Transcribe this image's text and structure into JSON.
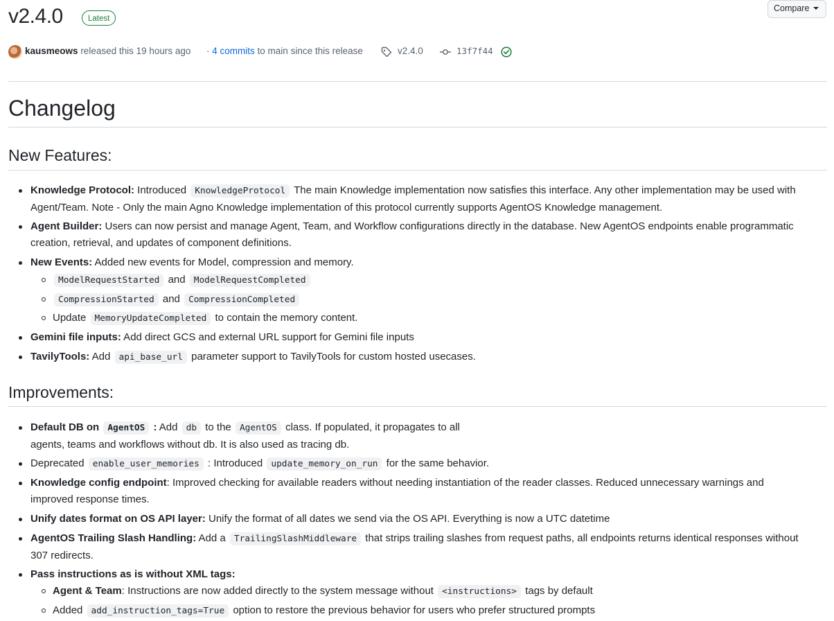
{
  "release": {
    "version": "v2.4.0",
    "badge": "Latest",
    "compare_label": "Compare",
    "author": "kausmeows",
    "released_text": "released this 19 hours ago",
    "commits_link": "4 commits",
    "commits_suffix": "to main since this release",
    "tag": "v2.4.0",
    "commit": "13f7f44"
  },
  "changelog": {
    "title": "Changelog",
    "new_features_heading": "New Features:",
    "improvements_heading": "Improvements:",
    "f1": {
      "bold": "Knowledge Protocol:",
      "t1": " Introduced",
      "code": "KnowledgeProtocol",
      "t2": " The main Knowledge implementation now satisfies this interface. Any other implementation may be used with",
      "line2": "Agent/Team. Note - Only the main Agno Knowledge implementation of this protocol currently supports AgentOS Knowledge management."
    },
    "f2": {
      "bold": "Agent Builder:",
      "t1": " Users can now persist and manage Agent, Team, and Workflow configurations directly in the database. New AgentOS endpoints enable programmatic",
      "line2": "creation, retrieval, and updates of component definitions."
    },
    "f3": {
      "bold": "New Events:",
      "t1": " Added new events for Model, compression and memory."
    },
    "f3a": {
      "c1": "ModelRequestStarted",
      "and": "and",
      "c2": "ModelRequestCompleted"
    },
    "f3b": {
      "c1": "CompressionStarted",
      "and": "and",
      "c2": "CompressionCompleted"
    },
    "f3c": {
      "t1": "Update",
      "code": "MemoryUpdateCompleted",
      "t2": "to contain the memory content."
    },
    "f4": {
      "bold": "Gemini file inputs:",
      "t1": " Add direct GCS and external URL support for Gemini file inputs"
    },
    "f5": {
      "bold": "TavilyTools:",
      "t1": " Add",
      "code": "api_base_url",
      "t2": "parameter support to TavilyTools for custom hosted usecases."
    },
    "i1": {
      "bold": "Default DB on",
      "bcode": "AgentOS",
      "bold2": " :",
      "t1": " Add",
      "code1": "db",
      "t2": "to the",
      "code2": "AgentOS",
      "t3": "class. If populated, it propagates to all",
      "line2": "agents, teams and workflows without db. It is also used as tracing db."
    },
    "i2": {
      "t1": "Deprecated",
      "code1": "enable_user_memories",
      "t2": ": Introduced",
      "code2": "update_memory_on_run",
      "t3": "for the same behavior."
    },
    "i3": {
      "bold": "Knowledge config endpoint",
      "t1": ": Improved checking for available readers without needing instantiation of the reader classes. Reduced unnecessary warnings and",
      "line2": "improved response times."
    },
    "i4": {
      "bold": "Unify dates format on OS API layer:",
      "t1": " Unify the format of all dates we send via the OS API. Everything is now a UTC datetime"
    },
    "i5": {
      "bold": "AgentOS Trailing Slash Handling:",
      "t1": " Add a",
      "code": "TrailingSlashMiddleware",
      "t2": "that strips trailing slashes from request paths, all endpoints returns identical responses without",
      "line2": "307 redirects."
    },
    "i6": {
      "bold": "Pass instructions as is without XML tags:"
    },
    "i6a": {
      "bold": "Agent & Team",
      "t1": ": Instructions are now added directly to the system message without",
      "code": "<instructions>",
      "t2": "tags by default"
    },
    "i6b": {
      "t1": "Added",
      "code": "add_instruction_tags=True",
      "t2": "option to restore the previous behavior for users who prefer structured prompts"
    }
  },
  "colors": {
    "accent": "#0969da",
    "success": "#1a7f37",
    "text": "#1f2328",
    "muted": "#59636e"
  },
  "icons": [
    "tag-icon",
    "commit-icon",
    "check-circle-icon",
    "caret-down-icon"
  ]
}
